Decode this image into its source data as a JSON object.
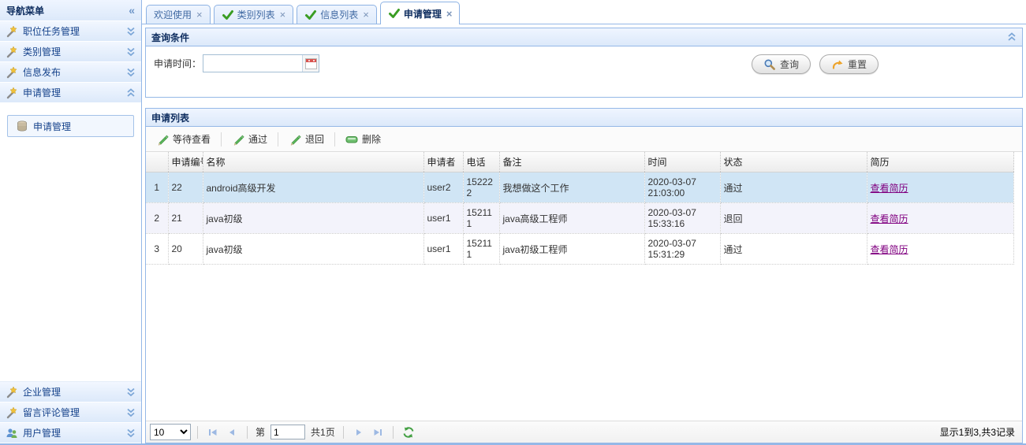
{
  "sidebar": {
    "title": "导航菜单",
    "items": [
      {
        "label": "职位任务管理",
        "icon": "wand-icon",
        "state": "collapsed"
      },
      {
        "label": "类别管理",
        "icon": "wand-icon",
        "state": "collapsed"
      },
      {
        "label": "信息发布",
        "icon": "wand-icon",
        "state": "collapsed"
      },
      {
        "label": "申请管理",
        "icon": "wand-icon",
        "state": "expanded",
        "children": [
          {
            "label": "申请管理",
            "icon": "database-icon"
          }
        ]
      },
      {
        "label": "企业管理",
        "icon": "wand-icon",
        "state": "collapsed"
      },
      {
        "label": "留言评论管理",
        "icon": "wand-icon",
        "state": "collapsed"
      },
      {
        "label": "用户管理",
        "icon": "users-icon",
        "state": "collapsed"
      }
    ]
  },
  "tabs": [
    {
      "label": "欢迎使用",
      "close": "×",
      "checked": false,
      "active": false
    },
    {
      "label": "类别列表",
      "close": "×",
      "checked": true,
      "active": false
    },
    {
      "label": "信息列表",
      "close": "×",
      "checked": true,
      "active": false
    },
    {
      "label": "申请管理",
      "close": "×",
      "checked": true,
      "active": true
    }
  ],
  "query": {
    "title": "查询条件",
    "time_label": "申请时间：",
    "time_value": "",
    "search_label": "查询",
    "reset_label": "重置"
  },
  "list": {
    "title": "申请列表",
    "toolbar": [
      {
        "label": "等待查看",
        "icon": "pencil-icon"
      },
      {
        "label": "通过",
        "icon": "pencil-icon"
      },
      {
        "label": "退回",
        "icon": "pencil-icon"
      },
      {
        "label": "删除",
        "icon": "remove-icon"
      }
    ],
    "columns": {
      "id": "申请编号",
      "name": "名称",
      "applicant": "申请者",
      "phone": "电话",
      "remark": "备注",
      "time": "时间",
      "status": "状态",
      "resume": "简历"
    },
    "rows": [
      {
        "index": "1",
        "id": "22",
        "name": "android高级开发",
        "applicant": "user2",
        "phone": "152222",
        "remark": "我想做这个工作",
        "time": "2020-03-07 21:03:00",
        "status": "通过",
        "resume_link": "查看简历",
        "selected": true
      },
      {
        "index": "2",
        "id": "21",
        "name": "java初级",
        "applicant": "user1",
        "phone": "152111",
        "remark": "java高级工程师",
        "time": "2020-03-07 15:33:16",
        "status": "退回",
        "resume_link": "查看简历",
        "selected": false
      },
      {
        "index": "3",
        "id": "20",
        "name": "java初级",
        "applicant": "user1",
        "phone": "152111",
        "remark": "java初级工程师",
        "time": "2020-03-07 15:31:29",
        "status": "通过",
        "resume_link": "查看简历",
        "selected": false
      }
    ]
  },
  "pagination": {
    "page_size": "10",
    "page_prefix": "第",
    "page_value": "1",
    "page_suffix": "共1页",
    "status": "显示1到3,共3记录"
  },
  "colors": {
    "accent_border": "#95B8E7",
    "panel_title": "#0E2D5F",
    "selected_row": "#D0E5F5",
    "alt_row": "#F3F3FB",
    "link": "#800080",
    "tab_check_green": "#3A9D23",
    "tool_icon_green": "#5CB85C"
  }
}
